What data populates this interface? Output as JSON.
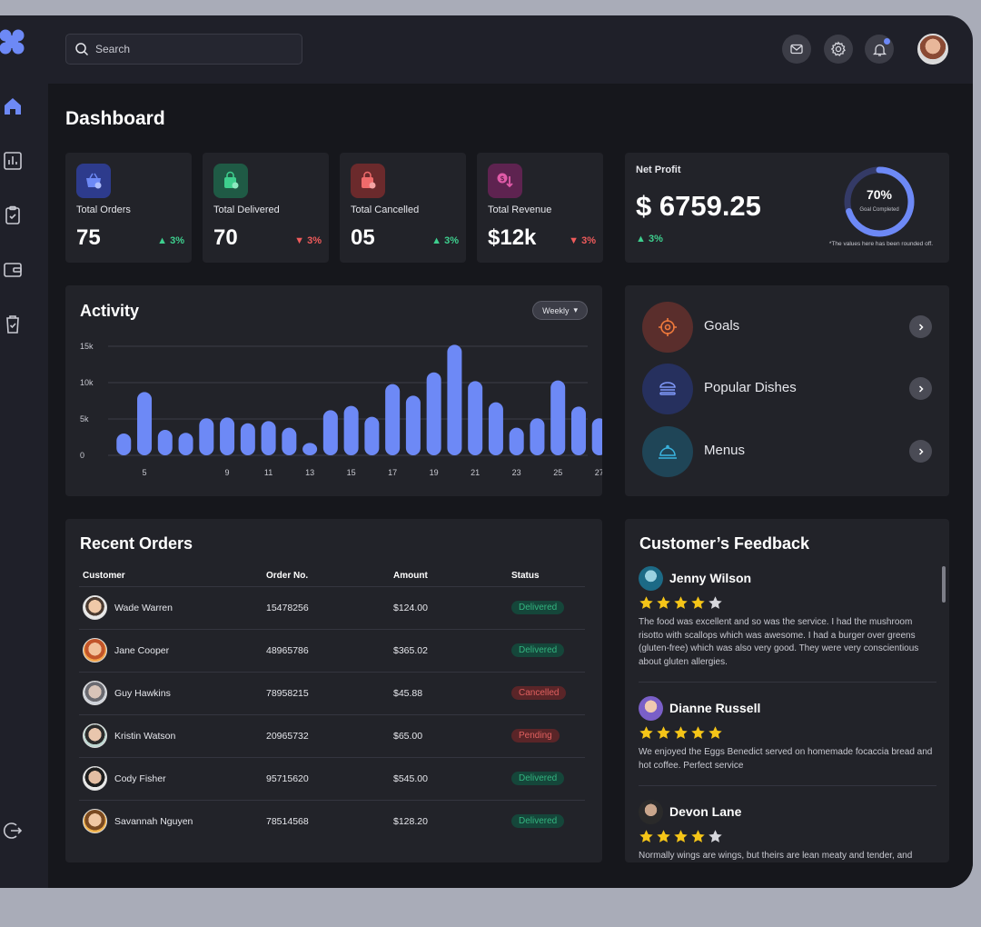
{
  "search": {
    "placeholder": "Search"
  },
  "page_title": "Dashboard",
  "colors": {
    "accent": "#6d89f6",
    "up": "#3ecf8e",
    "down": "#ef5b5b"
  },
  "stats": [
    {
      "label": "Total Orders",
      "value": "75",
      "change": "3%",
      "direction": "up",
      "icon": "basket-icon"
    },
    {
      "label": "Total Delivered",
      "value": "70",
      "change": "3%",
      "direction": "down",
      "icon": "shopping-bag-check-icon"
    },
    {
      "label": "Total Cancelled",
      "value": "05",
      "change": "3%",
      "direction": "up",
      "icon": "shopping-bag-cancel-icon"
    },
    {
      "label": "Total Revenue",
      "value": "$12k",
      "change": "3%",
      "direction": "down",
      "icon": "revenue-icon"
    }
  ],
  "net_profit": {
    "label": "Net Profit",
    "value": "$ 6759.25",
    "change": "3%",
    "goal_percent": "70%",
    "goal_fraction": 0.7,
    "goal_label": "Goal Completed",
    "note": "*The values here has been rounded off."
  },
  "activity": {
    "title": "Activity",
    "period": "Weekly"
  },
  "chart_data": {
    "type": "bar",
    "title": "Activity",
    "x": [
      4,
      5,
      6,
      7,
      8,
      9,
      10,
      11,
      12,
      13,
      14,
      15,
      16,
      17,
      18,
      19,
      20,
      21,
      22,
      23,
      24,
      25,
      26,
      27
    ],
    "x_tick_labels": [
      "5",
      "9",
      "11",
      "13",
      "15",
      "17",
      "19",
      "21",
      "23",
      "25",
      "27"
    ],
    "x_tick_positions": [
      5,
      9,
      11,
      13,
      15,
      17,
      19,
      21,
      23,
      25,
      27
    ],
    "values": [
      3000,
      8700,
      3500,
      3100,
      5100,
      5200,
      4400,
      4700,
      3800,
      1700,
      6200,
      6800,
      5300,
      9800,
      8200,
      11400,
      15200,
      10200,
      7300,
      3800,
      5100,
      10300,
      6700,
      5100
    ],
    "y_tick_labels": [
      "15k",
      "10k",
      "5k",
      "0"
    ],
    "ylim": [
      0,
      15000
    ],
    "grid": true
  },
  "quick_links": [
    {
      "label": "Goals",
      "icon": "target-icon"
    },
    {
      "label": "Popular Dishes",
      "icon": "burger-icon"
    },
    {
      "label": "Menus",
      "icon": "cloche-icon"
    }
  ],
  "recent_orders": {
    "title": "Recent Orders",
    "columns": [
      "Customer",
      "Order No.",
      "Amount",
      "Status"
    ],
    "rows": [
      {
        "customer": "Wade Warren",
        "order_no": "15478256",
        "amount": "$124.00",
        "status": "Delivered"
      },
      {
        "customer": "Jane Cooper",
        "order_no": "48965786",
        "amount": "$365.02",
        "status": "Delivered"
      },
      {
        "customer": "Guy Hawkins",
        "order_no": "78958215",
        "amount": "$45.88",
        "status": "Cancelled"
      },
      {
        "customer": "Kristin Watson",
        "order_no": "20965732",
        "amount": "$65.00",
        "status": "Pending"
      },
      {
        "customer": "Cody Fisher",
        "order_no": "95715620",
        "amount": "$545.00",
        "status": "Delivered"
      },
      {
        "customer": "Savannah Nguyen",
        "order_no": "78514568",
        "amount": "$128.20",
        "status": "Delivered"
      }
    ]
  },
  "feedback": {
    "title": "Customer’s Feedback",
    "items": [
      {
        "name": "Jenny Wilson",
        "rating": 4,
        "text": "The food was excellent and so was the service.  I had the mushroom risotto with scallops which was awesome. I had a burger over greens (gluten-free) which was also very good. They were very conscientious about gluten allergies."
      },
      {
        "name": "Dianne Russell",
        "rating": 5,
        "text": "We enjoyed the Eggs Benedict served on homemade focaccia bread and hot coffee.  Perfect  service"
      },
      {
        "name": "Devon Lane",
        "rating": 4,
        "text": "Normally wings are wings, but theirs are lean meaty and tender, and"
      }
    ]
  }
}
